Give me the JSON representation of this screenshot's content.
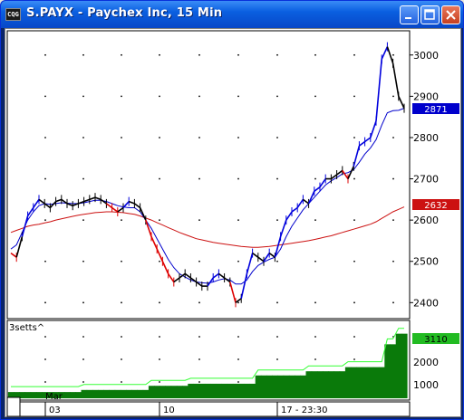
{
  "window": {
    "icon_text": "CQG",
    "title": "S.PAYX - Paychex Inc, 15 Min"
  },
  "price_axis": {
    "ticks": [
      "3000",
      "2900",
      "2800",
      "2700",
      "2600",
      "2500",
      "2400"
    ],
    "last_price_label": "2871",
    "ma_label": "2632",
    "last_price_color": "#0000cc",
    "ma_label_color": "#cc1111"
  },
  "volume_panel": {
    "label": "3setts^",
    "ticks": [
      "2000",
      "1000"
    ],
    "last_value_label": "3110",
    "last_value_color": "#22bb22"
  },
  "time_axis": {
    "month_label": "Mar",
    "labels": [
      "03",
      "10",
      "17 - 23:30"
    ]
  },
  "colors": {
    "bar_up": "#0000dd",
    "bar_down": "#dd0000",
    "bar_neutral": "#000000",
    "ma_fast": "#0000cc",
    "ma_slow": "#cc1111",
    "volume_fill": "#0a7a0a",
    "volume_line": "#33ff33"
  },
  "chart_data": {
    "type": "line",
    "ylim": [
      2370,
      3050
    ],
    "series": [
      {
        "color": "#000000",
        "values": [
          2520,
          2510,
          2560,
          2610,
          2630,
          2650,
          2640,
          2630,
          2645,
          2650,
          2640,
          2635,
          2640,
          2645,
          2650,
          2655,
          2650,
          2640,
          2630,
          2620,
          2630,
          2645,
          2640,
          2630,
          2600,
          2560,
          2530,
          2500,
          2470,
          2450,
          2460,
          2470,
          2460,
          2450,
          2440,
          2440,
          2460,
          2470,
          2460,
          2450,
          2400,
          2410,
          2470,
          2520,
          2510,
          2500,
          2520,
          2510,
          2560,
          2600,
          2620,
          2630,
          2650,
          2640,
          2670,
          2680,
          2700,
          2700,
          2710,
          2720,
          2700,
          2730,
          2780,
          2790,
          2800,
          2840,
          2990,
          3020,
          2980,
          2900,
          2871
        ]
      },
      {
        "color": "#0000cc",
        "values": [
          2530,
          2540,
          2570,
          2600,
          2620,
          2635,
          2640,
          2638,
          2640,
          2642,
          2641,
          2640,
          2640,
          2642,
          2645,
          2648,
          2648,
          2645,
          2640,
          2635,
          2632,
          2630,
          2630,
          2620,
          2600,
          2580,
          2555,
          2530,
          2505,
          2485,
          2470,
          2462,
          2455,
          2450,
          2448,
          2447,
          2450,
          2455,
          2458,
          2455,
          2445,
          2445,
          2455,
          2475,
          2490,
          2498,
          2505,
          2510,
          2530,
          2560,
          2585,
          2605,
          2625,
          2640,
          2655,
          2670,
          2685,
          2695,
          2703,
          2712,
          2715,
          2722,
          2740,
          2760,
          2775,
          2795,
          2830,
          2860,
          2865,
          2866,
          2871
        ]
      },
      {
        "color": "#cc1111",
        "values": [
          2570,
          2575,
          2580,
          2585,
          2588,
          2590,
          2593,
          2596,
          2600,
          2603,
          2606,
          2609,
          2612,
          2614,
          2616,
          2618,
          2619,
          2620,
          2620,
          2619,
          2618,
          2616,
          2614,
          2610,
          2605,
          2600,
          2594,
          2588,
          2582,
          2576,
          2570,
          2565,
          2560,
          2555,
          2552,
          2549,
          2546,
          2544,
          2542,
          2540,
          2538,
          2536,
          2535,
          2534,
          2534,
          2535,
          2536,
          2538,
          2540,
          2542,
          2544,
          2546,
          2548,
          2550,
          2553,
          2556,
          2559,
          2562,
          2566,
          2570,
          2574,
          2578,
          2582,
          2586,
          2590,
          2596,
          2604,
          2612,
          2620,
          2626,
          2632
        ]
      }
    ],
    "volume": {
      "ylim": [
        0,
        3400
      ],
      "values": [
        300,
        300,
        300,
        300,
        300,
        300,
        300,
        300,
        300,
        300,
        300,
        300,
        300,
        400,
        400,
        400,
        400,
        400,
        400,
        400,
        400,
        400,
        400,
        400,
        400,
        600,
        600,
        600,
        600,
        600,
        600,
        600,
        700,
        700,
        700,
        700,
        700,
        700,
        700,
        700,
        700,
        700,
        700,
        700,
        1100,
        1100,
        1100,
        1100,
        1100,
        1100,
        1100,
        1100,
        1100,
        1300,
        1300,
        1300,
        1300,
        1300,
        1300,
        1300,
        1500,
        1500,
        1500,
        1500,
        1500,
        1500,
        1500,
        2600,
        2600,
        3110,
        3110
      ]
    }
  }
}
